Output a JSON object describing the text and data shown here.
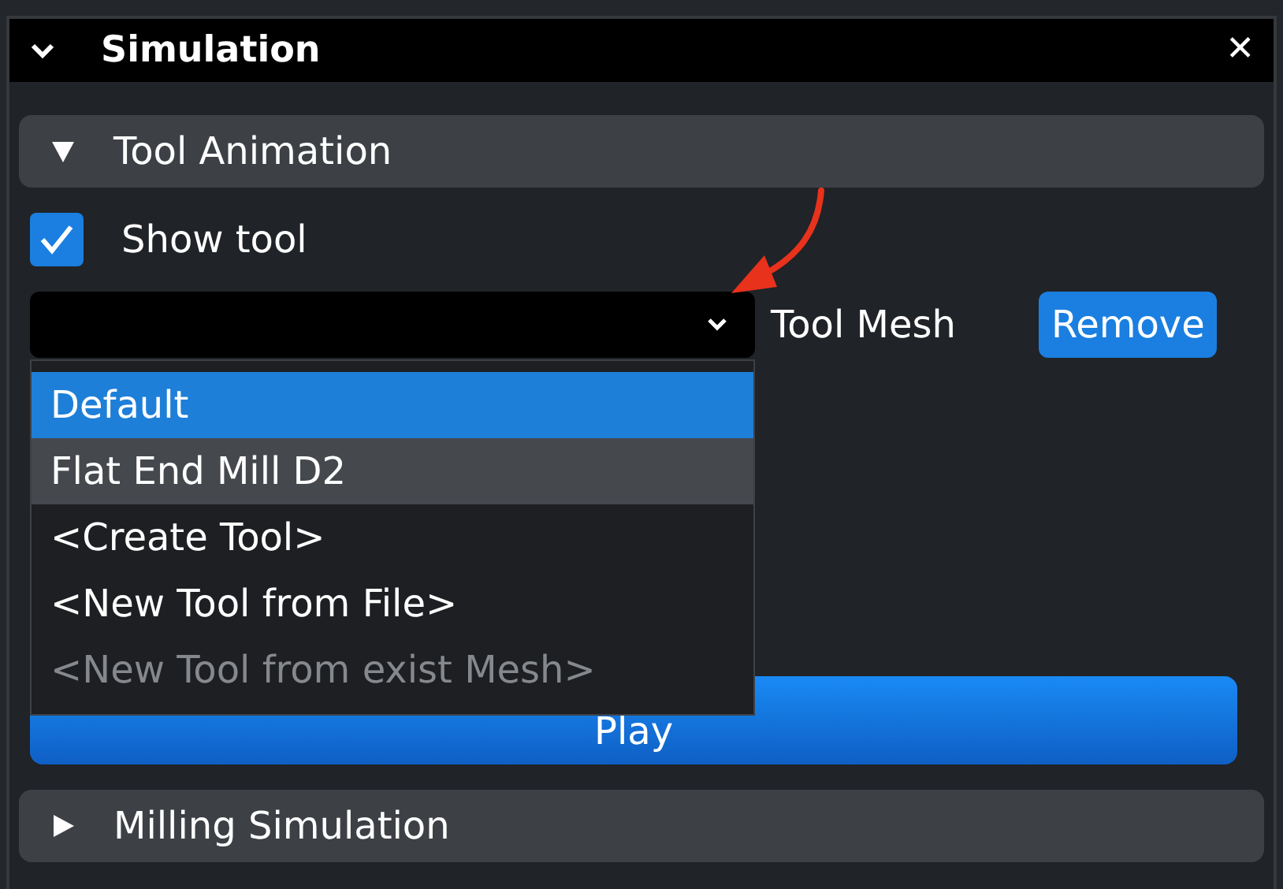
{
  "panel": {
    "title": "Simulation",
    "close": "✕"
  },
  "sections": [
    {
      "title": "Tool Animation",
      "expanded": true
    },
    {
      "title": "Milling Simulation",
      "expanded": false
    }
  ],
  "show_tool": {
    "label": "Show tool",
    "checked": true
  },
  "tool_mesh": {
    "label": "Tool Mesh",
    "open": true,
    "options": [
      {
        "label": "Default",
        "selected": true,
        "hovered": false,
        "disabled": false
      },
      {
        "label": "Flat End Mill D2",
        "selected": false,
        "hovered": true,
        "disabled": false
      },
      {
        "label": "<Create Tool>",
        "selected": false,
        "hovered": false,
        "disabled": false
      },
      {
        "label": "<New Tool from File>",
        "selected": false,
        "hovered": false,
        "disabled": false
      },
      {
        "label": "<New Tool from exist Mesh>",
        "selected": false,
        "hovered": false,
        "disabled": true
      }
    ]
  },
  "remove_button": "Remove",
  "play_button": "Play"
}
